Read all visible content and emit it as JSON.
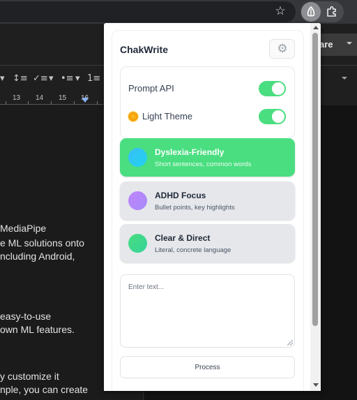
{
  "browser": {
    "bookmark_icon": "star-icon",
    "active_extension_icon": "leaf-icon",
    "extensions_icon": "puzzle-icon"
  },
  "docs": {
    "share_label": "are",
    "ruler_numbers": [
      "13",
      "14",
      "15",
      "16"
    ],
    "lines": [
      "MediaPipe",
      "e ML solutions onto",
      "ncluding Android,",
      "easy-to-use",
      "own ML features.",
      "y customize it",
      "nple, you can create"
    ]
  },
  "popup": {
    "title": "ChakWrite",
    "settings_icon": "gear-icon",
    "toggles": [
      {
        "label": "Prompt API",
        "on": true
      },
      {
        "label": "Light Theme",
        "icon": "sun-icon",
        "on": true
      }
    ],
    "modes": [
      {
        "title": "Dyslexia-Friendly",
        "desc": "Short sentences, common words",
        "color": "#38bdf8",
        "active": true
      },
      {
        "title": "ADHD Focus",
        "desc": "Bullet points, key highlights",
        "color": "#c084fc",
        "active": false
      },
      {
        "title": "Clear & Direct",
        "desc": "Literal, concrete language",
        "color": "#4ade80",
        "active": false
      }
    ],
    "input_placeholder": "Enter text...",
    "process_label": "Process"
  },
  "colors": {
    "accent_green": "#4ade80",
    "dark_background": "#1f1f1f"
  }
}
